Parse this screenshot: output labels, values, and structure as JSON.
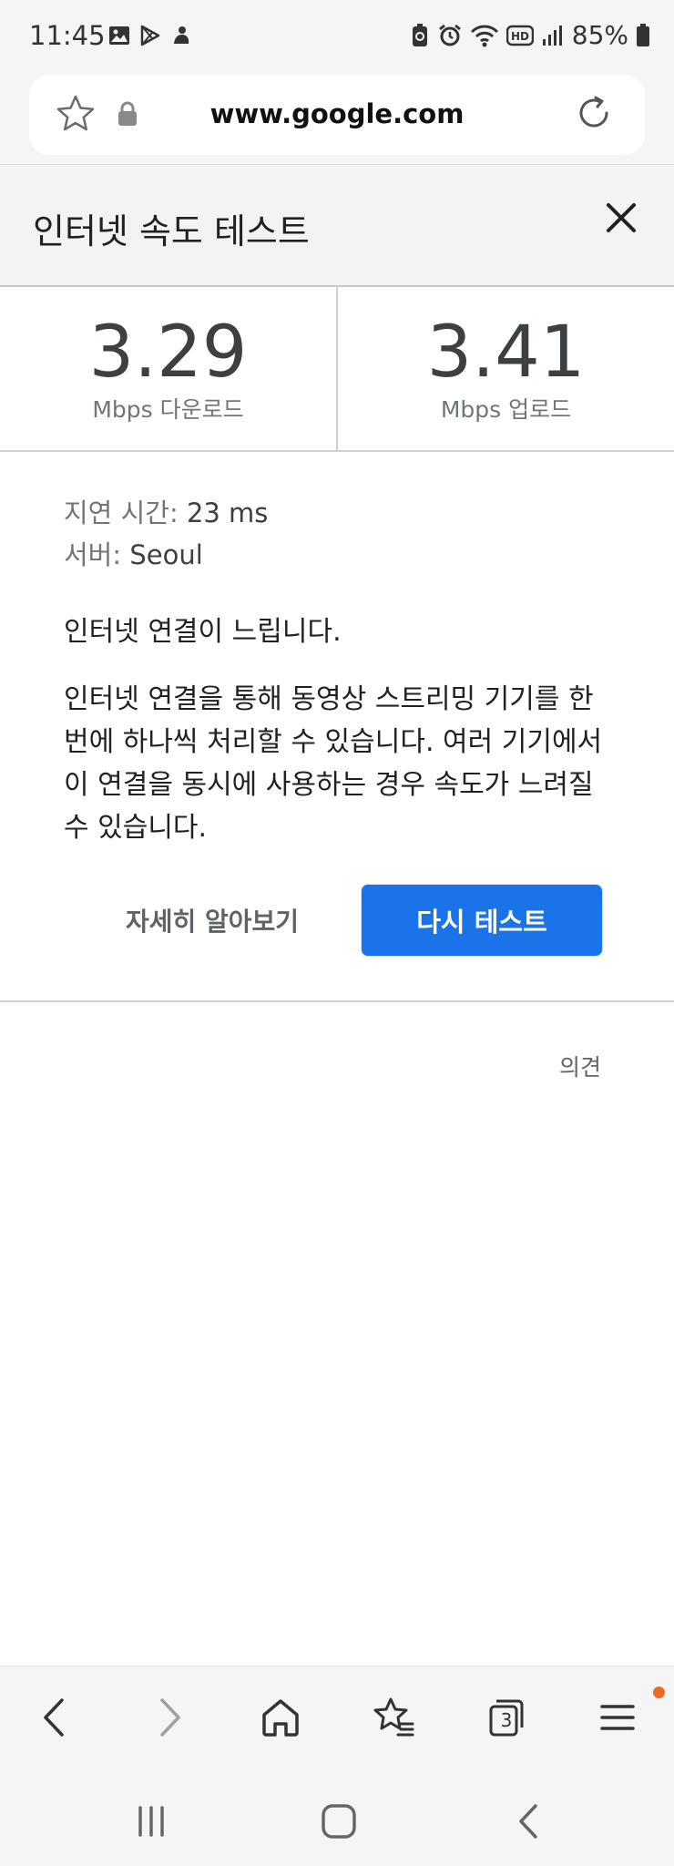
{
  "status_bar": {
    "time": "11:45",
    "battery": "85%",
    "icons_left": [
      "gallery-icon",
      "play-store-icon",
      "bixby-icon"
    ],
    "icons_right": [
      "battery-saver-icon",
      "alarm-icon",
      "wifi-icon",
      "hd-voice-icon",
      "signal-icon",
      "battery-icon"
    ]
  },
  "url_bar": {
    "url": "www.google.com"
  },
  "header": {
    "title": "인터넷 속도 테스트"
  },
  "speeds": {
    "download": {
      "value": "3.29",
      "unit": "Mbps 다운로드"
    },
    "upload": {
      "value": "3.41",
      "unit": "Mbps 업로드"
    }
  },
  "info": {
    "latency_label": "지연 시간:",
    "latency_value": "23 ms",
    "server_label": "서버:",
    "server_value": "Seoul",
    "summary": "인터넷 연결이 느립니다.",
    "description": "인터넷 연결을 통해 동영상 스트리밍 기기를 한 번에 하나씩 처리할 수 있습니다. 여러 기기에서 이 연결을 동시에 사용하는 경우 속도가 느려질 수 있습니다."
  },
  "actions": {
    "learn_more": "자세히 알아보기",
    "retest": "다시 테스트"
  },
  "feedback": "의견",
  "toolbar": {
    "tab_count": "3",
    "accent_color": "#f06a23"
  },
  "colors": {
    "primary_button": "#1a73e8"
  }
}
